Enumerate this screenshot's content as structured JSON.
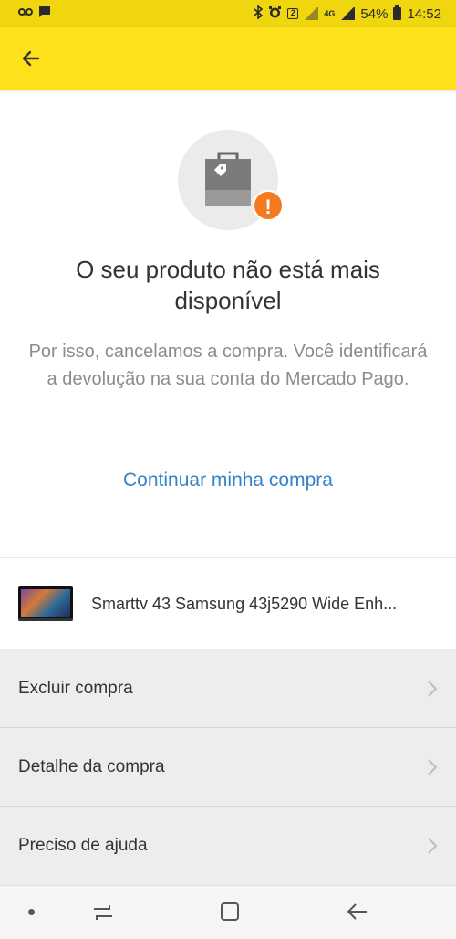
{
  "status_bar": {
    "battery": "54%",
    "time": "14:52",
    "sim_badge": "2",
    "network": "4G"
  },
  "header": {
    "back_icon": "arrow-left-icon"
  },
  "message": {
    "title": "O seu produto não está mais disponível",
    "subtitle": "Por isso, cancelamos a compra. Você identificará a devolução na sua conta do Mercado Pago.",
    "link": "Continuar minha compra"
  },
  "product": {
    "name": "Smarttv 43 Samsung 43j5290 Wide Enh..."
  },
  "menu": {
    "items": [
      {
        "label": "Excluir compra"
      },
      {
        "label": "Detalhe da compra"
      },
      {
        "label": "Preciso de ajuda"
      }
    ]
  },
  "colors": {
    "header_yellow": "#fde11a",
    "link_blue": "#3483c7",
    "alert_orange": "#f47a20"
  }
}
